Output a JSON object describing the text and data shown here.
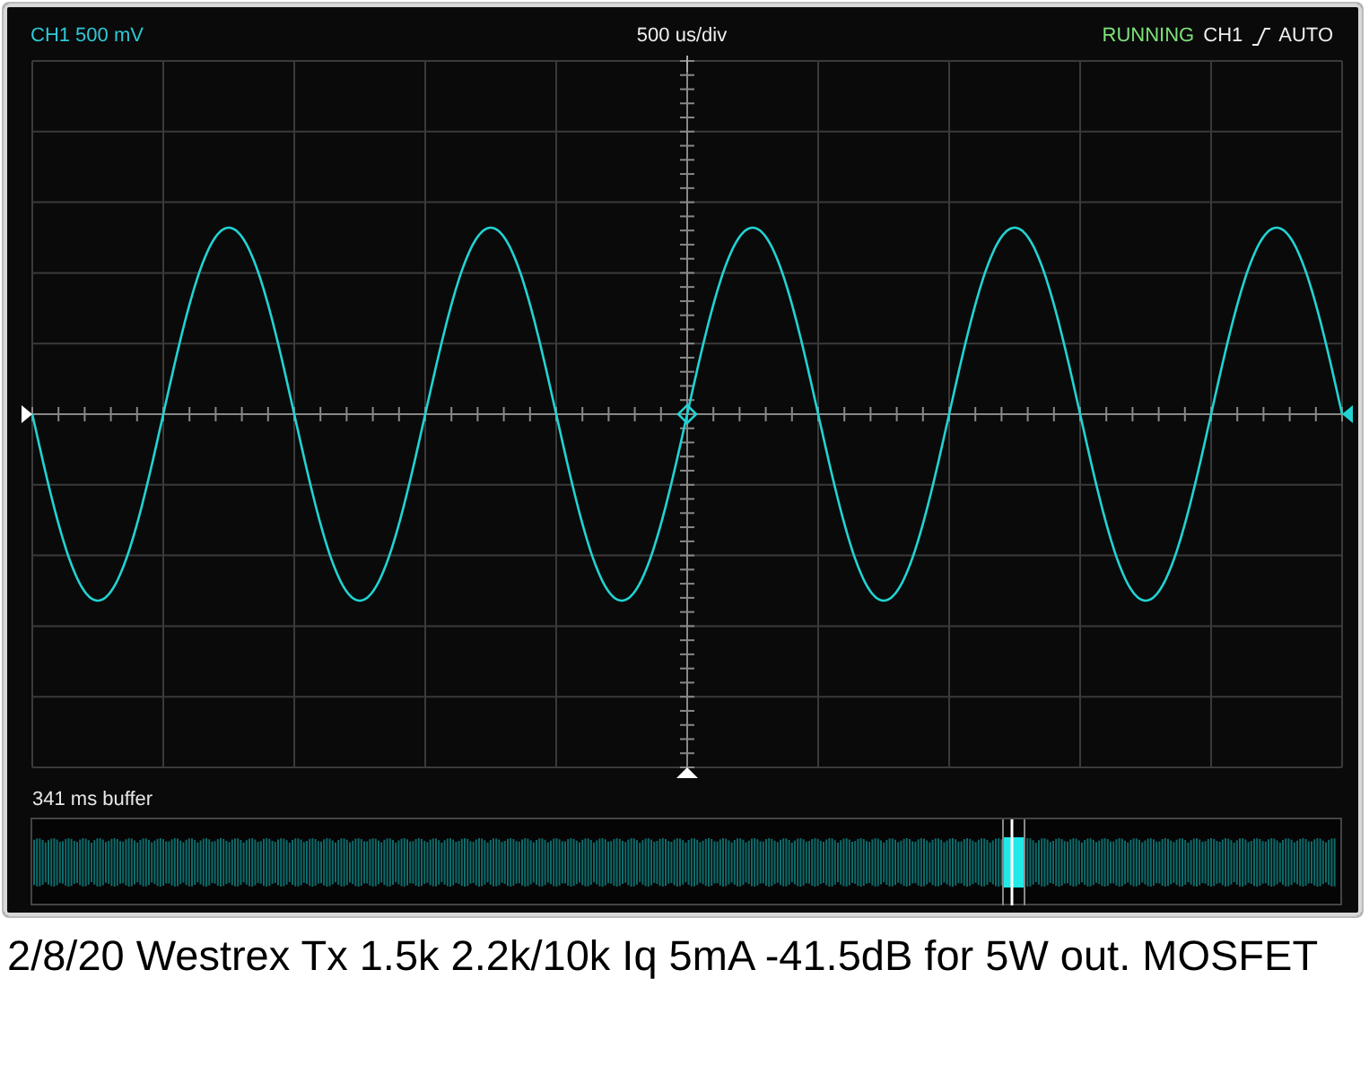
{
  "scope": {
    "channel_scale": "CH1 500 mV",
    "timebase": "500 us/div",
    "run_state": "RUNNING",
    "trigger_channel": "CH1",
    "trigger_mode": "AUTO",
    "buffer_label": "341 ms buffer"
  },
  "caption": "2/8/20 Westrex Tx 1.5k 2.2k/10k Iq 5mA -41.5dB for 5W out. MOSFET"
}
